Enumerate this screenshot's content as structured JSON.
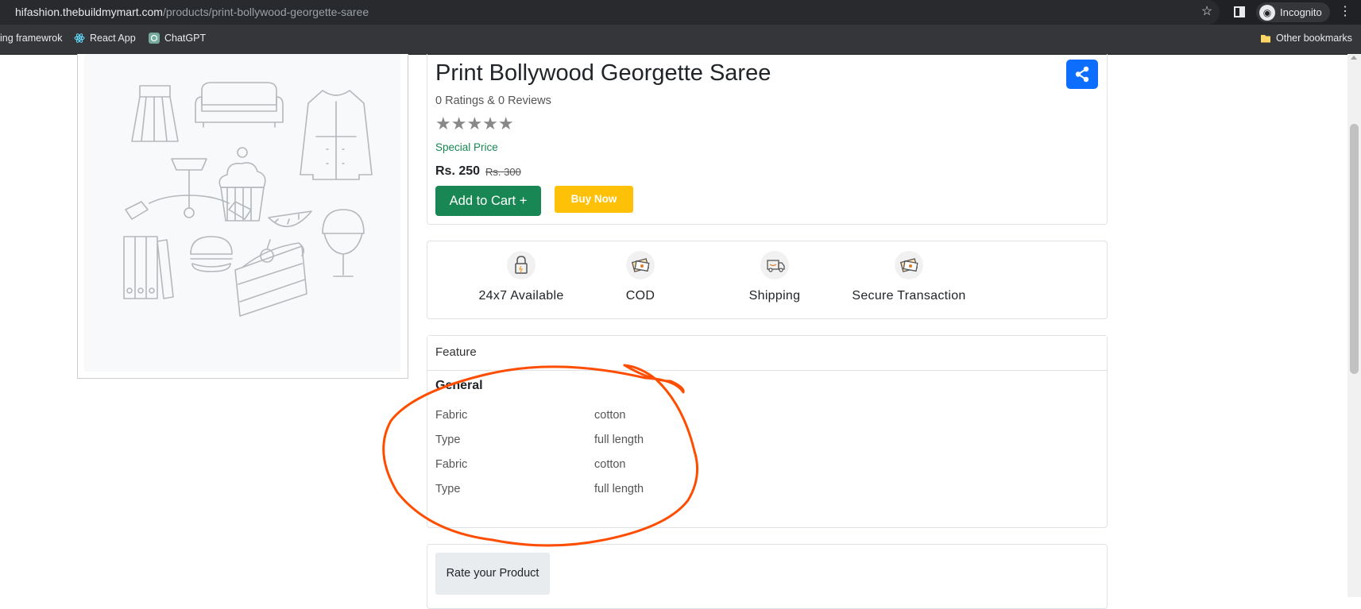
{
  "browser": {
    "url_host": "hifashion.thebuildmymart.com",
    "url_path": "/products/print-bollywood-georgette-saree",
    "profile_label": "Incognito",
    "bookmarks": [
      {
        "label": "ing framewrok"
      },
      {
        "label": "React App"
      },
      {
        "label": "ChatGPT"
      }
    ],
    "other_bookmarks": "Other bookmarks"
  },
  "product": {
    "title": "Print Bollywood Georgette Saree",
    "ratings_text": "0 Ratings & 0 Reviews",
    "stars": "★★★★★",
    "star_count": 0,
    "special_label": "Special Price",
    "price": "Rs. 250",
    "mrp": "Rs. 300",
    "add_to_cart": "Add to Cart +",
    "buy_now": "Buy Now"
  },
  "services": [
    {
      "label": "24x7 Available",
      "icon": "lock-icon"
    },
    {
      "label": "COD",
      "icon": "cash-icon"
    },
    {
      "label": "Shipping",
      "icon": "truck-icon"
    },
    {
      "label": "Secure Transaction",
      "icon": "card-icon"
    }
  ],
  "spec": {
    "header": "Feature",
    "group": "General",
    "rows": [
      {
        "key": "Fabric",
        "value": "cotton"
      },
      {
        "key": "Type",
        "value": "full length"
      },
      {
        "key": "Fabric",
        "value": "cotton"
      },
      {
        "key": "Type",
        "value": "full length"
      }
    ]
  },
  "rate": {
    "label": "Rate your Product"
  },
  "colors": {
    "success": "#198754",
    "primary": "#0d6efd",
    "warning": "#ffc107",
    "annotation": "#ff4d00"
  }
}
